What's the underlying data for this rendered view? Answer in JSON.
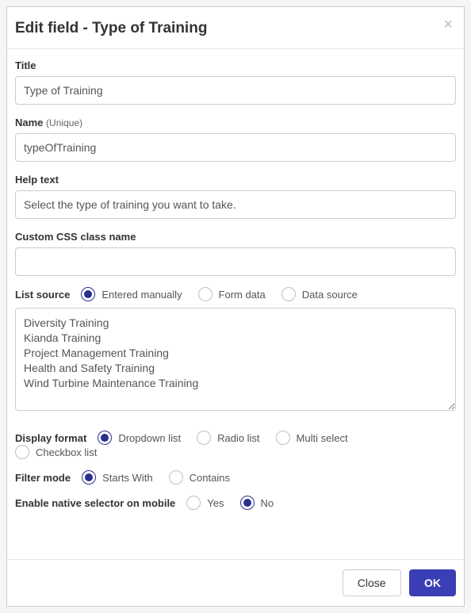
{
  "header": {
    "title": "Edit field - Type of Training"
  },
  "fields": {
    "title": {
      "label": "Title",
      "value": "Type of Training"
    },
    "name": {
      "label": "Name",
      "sublabel": "(Unique)",
      "value": "typeOfTraining"
    },
    "help": {
      "label": "Help text",
      "value": "Select the type of training you want to take."
    },
    "css": {
      "label": "Custom CSS class name",
      "value": ""
    }
  },
  "listSource": {
    "label": "List source",
    "options": [
      "Entered manually",
      "Form data",
      "Data source"
    ],
    "selected": 0,
    "items": "Diversity Training\nKianda Training\nProject Management Training\nHealth and Safety Training\nWind Turbine Maintenance Training"
  },
  "displayFormat": {
    "label": "Display format",
    "options": [
      "Dropdown list",
      "Radio list",
      "Multi select",
      "Checkbox list"
    ],
    "selected": 0
  },
  "filterMode": {
    "label": "Filter mode",
    "options": [
      "Starts With",
      "Contains"
    ],
    "selected": 0
  },
  "nativeSelector": {
    "label": "Enable native selector on mobile",
    "options": [
      "Yes",
      "No"
    ],
    "selected": 1
  },
  "footer": {
    "close": "Close",
    "ok": "OK"
  }
}
